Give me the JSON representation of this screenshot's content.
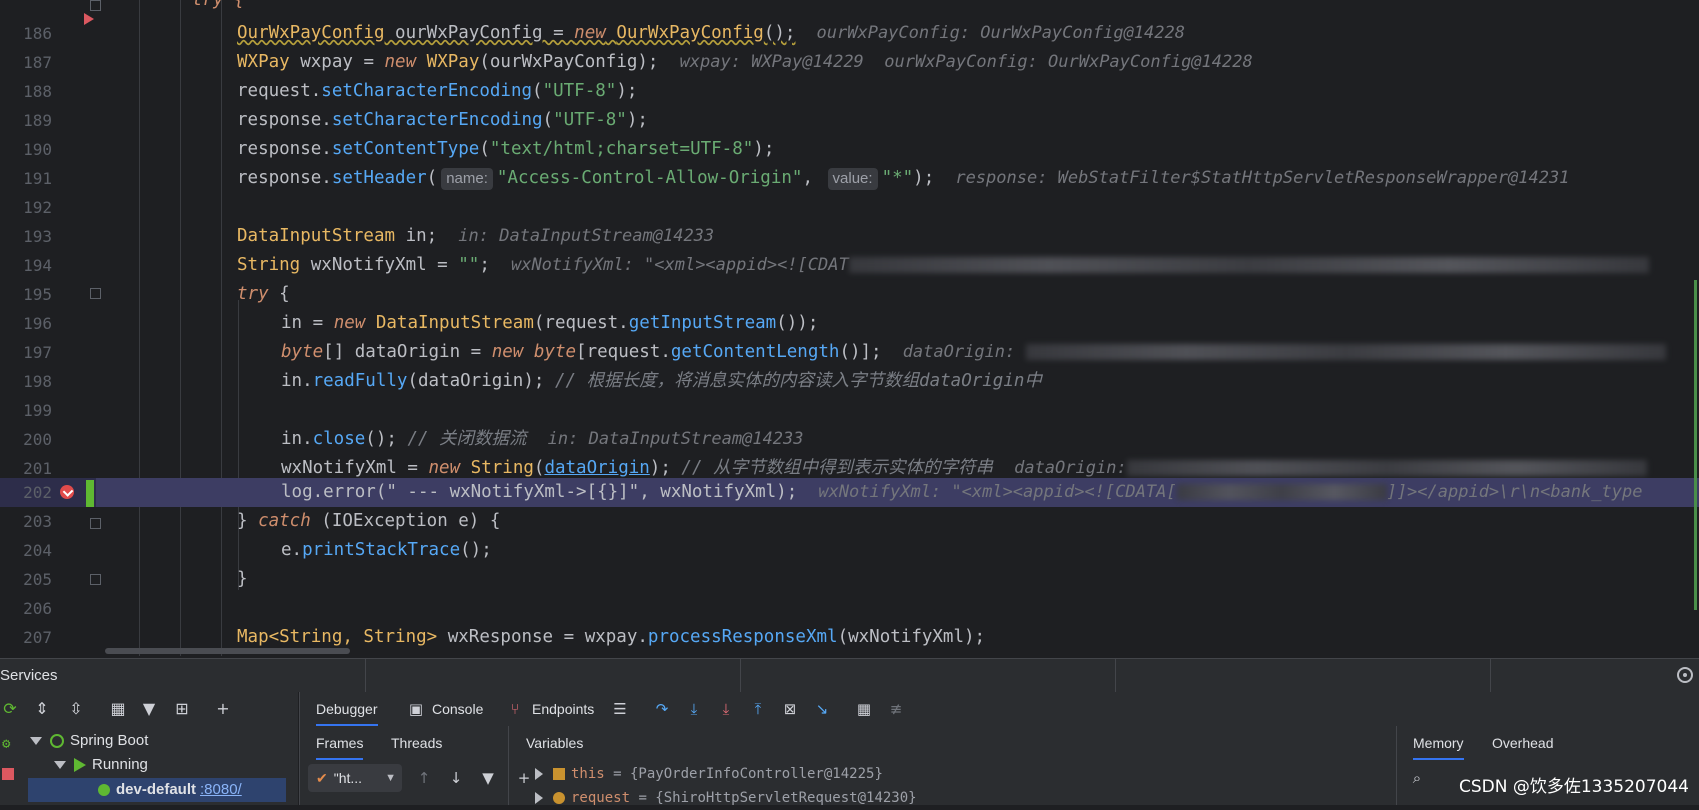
{
  "editor": {
    "line_numbers": [
      "186",
      "187",
      "188",
      "189",
      "190",
      "191",
      "192",
      "193",
      "194",
      "195",
      "196",
      "197",
      "198",
      "199",
      "200",
      "201",
      "202",
      "203",
      "204",
      "205",
      "206",
      "207"
    ],
    "top_partial": "try {",
    "l186": {
      "t1": "OurWxPayConfig",
      "t2": " ourWxPayConfig = ",
      "kw": "new",
      "t3": " ",
      "t4": "OurWxPayConfig",
      "t5": "();",
      "hint": "ourWxPayConfig: OurWxPayConfig@14228"
    },
    "l187": {
      "t1": "WXPay",
      "t2": " wxpay = ",
      "kw": "new",
      "t3": " ",
      "t4": "WXPay",
      "t5": "(ourWxPayConfig);",
      "hint": "wxpay: WXPay@14229  ourWxPayConfig: OurWxPayConfig@14228"
    },
    "l188": {
      "obj": "request.",
      "fn": "setCharacterEncoding",
      "p1": "(",
      "str": "\"UTF-8\"",
      "p2": ");"
    },
    "l189": {
      "obj": "response.",
      "fn": "setCharacterEncoding",
      "p1": "(",
      "str": "\"UTF-8\"",
      "p2": ");"
    },
    "l190": {
      "obj": "response.",
      "fn": "setContentType",
      "p1": "(",
      "str": "\"text/html;charset=UTF-8\"",
      "p2": ");"
    },
    "l191": {
      "obj": "response.",
      "fn": "setHeader",
      "p1": "(",
      "hint_name": "name:",
      "str1": "\"Access-Control-Allow-Origin\"",
      "comma": ", ",
      "hint_value": "value:",
      "str2": "\"*\"",
      "p2": ");",
      "hint": "response: WebStatFilter$StatHttpServletResponseWrapper@14231"
    },
    "l193": {
      "t1": "DataInputStream",
      "t2": " in;",
      "hint": "in: DataInputStream@14233"
    },
    "l194": {
      "t1": "String",
      "t2": " wxNotifyXml = ",
      "str": "\"\"",
      "t3": ";",
      "hint": "wxNotifyXml: \"<xml><appid><![CDAT"
    },
    "l195": {
      "kw": "try",
      "t": " {"
    },
    "l196": {
      "t1": "in = ",
      "kw": "new",
      "t2": " ",
      "t3": "DataInputStream",
      "t4": "(request.",
      "fn": "getInputStream",
      "t5": "());"
    },
    "l197": {
      "kw1": "byte",
      "t1": "[] dataOrigin = ",
      "kw2": "new",
      "t2": " ",
      "kw3": "byte",
      "t3": "[request.",
      "fn": "getContentLength",
      "t4": "()];",
      "hint": "dataOrigin:"
    },
    "l198": {
      "t1": "in.",
      "fn": "readFully",
      "t2": "(dataOrigin); ",
      "cm": "// 根据长度，将消息实体的内容读入字节数组dataOrigin中"
    },
    "l200": {
      "t1": "in.",
      "fn": "close",
      "t2": "(); ",
      "cm": "// 关闭数据流",
      "hint": "in: DataInputStream@14233"
    },
    "l201": {
      "t1": "wxNotifyXml = ",
      "kw": "new",
      "t2": " ",
      "t3": "String",
      "t4": "(",
      "ul": "dataOrigin",
      "t5": "); ",
      "cm": "// 从字节数组中得到表示实体的字符串",
      "hint": "dataOrigin:"
    },
    "l202": {
      "t1": "log.error(\" --- wxNotifyXml->[{}]\", wxNotifyXml);",
      "hint1": "wxNotifyXml: \"<xml><appid><![CDATA[",
      "hint2": "]]></appid>\\r\\n<bank_type"
    },
    "l203": {
      "t1": "} ",
      "kw": "catch",
      "t2": " (IOException e) {"
    },
    "l204": {
      "t1": "e.",
      "fn": "printStackTrace",
      "t2": "();"
    },
    "l205": {
      "t1": "}"
    },
    "l207": {
      "t1": "Map<String, String>",
      "t2": " wxResponse = wxpay.",
      "fn": "processResponseXml",
      "t3": "(wxNotifyXml);"
    }
  },
  "services": {
    "title": "Services",
    "tree": {
      "root": "Spring Boot",
      "group": "Running",
      "item_name": "dev-default",
      "item_port": ":8080/"
    }
  },
  "debugger": {
    "tabs": [
      "Debugger",
      "Console",
      "Endpoints"
    ],
    "subtabs": [
      "Frames",
      "Threads"
    ],
    "variables_label": "Variables",
    "thread_combo": "\"ht...",
    "variables": [
      {
        "name": "this",
        "value": " = {PayOrderInfoController@14225}"
      },
      {
        "name": "request",
        "value": " = {ShiroHttpServletRequest@14230}"
      }
    ],
    "right_tabs": [
      "Memory",
      "Overhead"
    ]
  },
  "watermark": "CSDN @饮多佐1335207044",
  "colors": {
    "accent": "#3574f0",
    "breakpoint": "#e04b4b",
    "current_line": "#3d3d63",
    "run": "#5fb832"
  }
}
